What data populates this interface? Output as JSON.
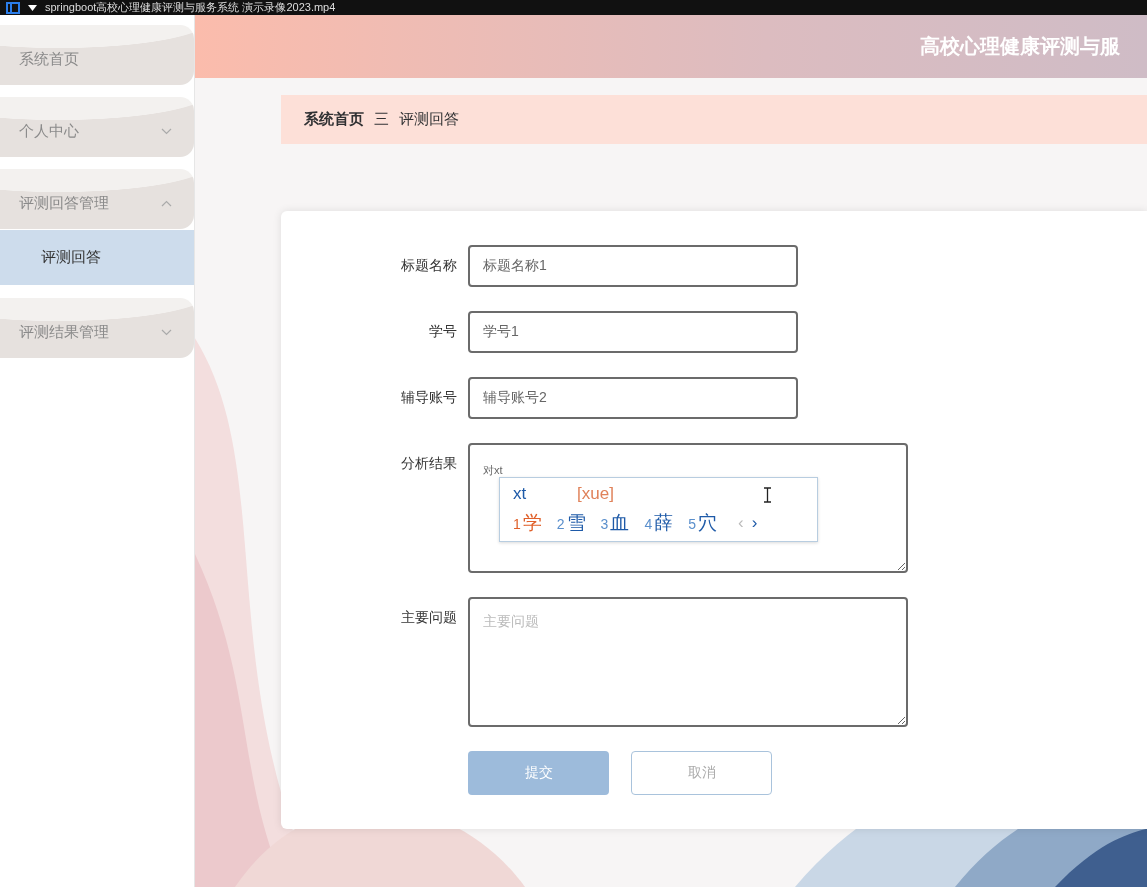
{
  "window": {
    "title": "springboot高校心理健康评测与服务系统 演示录像2023.mp4"
  },
  "header": {
    "title": "高校心理健康评测与服"
  },
  "sidebar": {
    "items": [
      {
        "label": "系统首页",
        "kind": "link"
      },
      {
        "label": "个人中心",
        "kind": "menu",
        "expanded": false
      },
      {
        "label": "评测回答管理",
        "kind": "menu",
        "expanded": true,
        "children": [
          {
            "label": "评测回答",
            "selected": true
          }
        ]
      },
      {
        "label": "评测结果管理",
        "kind": "menu",
        "expanded": false
      }
    ]
  },
  "breadcrumb": {
    "items": [
      "系统首页",
      "评测回答"
    ],
    "separator": "三"
  },
  "form": {
    "fields": [
      {
        "label": "标题名称",
        "kind": "input",
        "value": "标题名称1"
      },
      {
        "label": "学号",
        "kind": "input",
        "value": "学号1"
      },
      {
        "label": "辅导账号",
        "kind": "input",
        "value": "辅导账号2"
      },
      {
        "label": "分析结果",
        "kind": "textarea",
        "value": "对xt"
      },
      {
        "label": "主要问题",
        "kind": "textarea",
        "placeholder": "主要问题"
      }
    ],
    "buttons": [
      {
        "label": "提交",
        "kind": "primary"
      },
      {
        "label": "取消",
        "kind": "default"
      }
    ]
  },
  "ime": {
    "composition": "xt",
    "pinyin": "[xue]",
    "candidates": [
      {
        "index": "1",
        "text": "学",
        "selected": true
      },
      {
        "index": "2",
        "text": "雪",
        "selected": false
      },
      {
        "index": "3",
        "text": "血",
        "selected": false
      },
      {
        "index": "4",
        "text": "薛",
        "selected": false
      },
      {
        "index": "5",
        "text": "穴",
        "selected": false
      }
    ],
    "prev": "‹",
    "next": "›"
  }
}
